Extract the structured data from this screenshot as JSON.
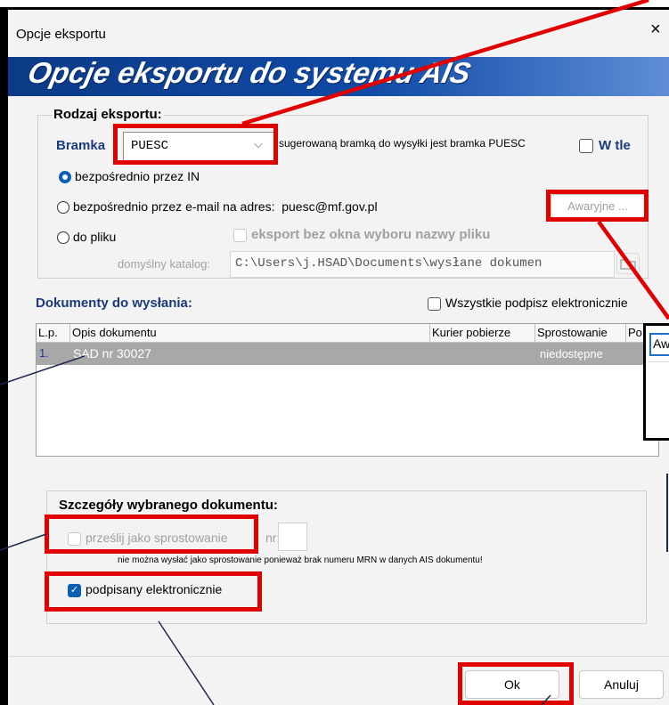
{
  "window": {
    "title": "Opcje eksportu",
    "close_icon": "×"
  },
  "banner": {
    "text": "Opcje eksportu do systemu AIS"
  },
  "export_type": {
    "group_title": "Rodzaj eksportu:",
    "gateway_label": "Bramka",
    "gateway_value": "PUESC",
    "gateway_hint": "sugerowaną bramką do wysyłki jest bramka PUESC",
    "background_label": "W tle",
    "options": [
      "bezpośrednio przez IN",
      "bezpośrednio przez e-mail na adres:  puesc@mf.gov.pl",
      "do pliku"
    ],
    "emergency_button": "Awaryjne ...",
    "no_dialog_label": "eksport bez okna wyboru nazwy pliku",
    "default_dir_label": "domyślny katalog:",
    "default_dir_value": "C:\\Users\\j.HSAD\\Documents\\wysłane dokumen"
  },
  "documents": {
    "title": "Dokumenty do wysłania:",
    "sign_all_label": "Wszystkie podpisz elektronicznie",
    "columns": [
      "L.p.",
      "Opis dokumentu",
      "Kurier pobierze",
      "Sprostowanie",
      "Po"
    ],
    "rows": [
      {
        "lp": "1.",
        "opis": "SAD nr 30027",
        "kurier": "",
        "sprost": "niedostępne"
      }
    ]
  },
  "details": {
    "title": "Szczegóły wybranego dokumentu:",
    "send_correction_label": "prześlij jako sprostowanie",
    "nr_label": "nr:",
    "correction_note": "nie można wysłać jako sprostowanie ponieważ brak numeru MRN w danych AIS dokumentu!",
    "signed_label": "podpisany elektronicznie"
  },
  "footer": {
    "ok": "Ok",
    "cancel": "Anuluj"
  },
  "popup": {
    "text": "Aw"
  },
  "colors": {
    "annotation_red": "#e00000",
    "banner_blue": "#0f4aa6",
    "callout_line": "#1b2a4a"
  }
}
